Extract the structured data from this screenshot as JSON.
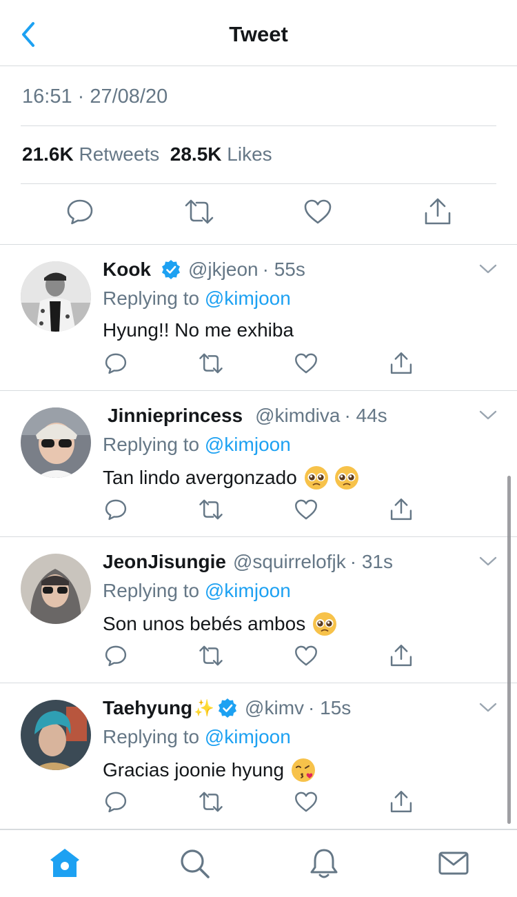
{
  "header": {
    "title": "Tweet",
    "back_icon": "chevron-left-icon"
  },
  "tweet": {
    "timestamp": "16:51 · 27/08/20",
    "retweets_count": "21.6K",
    "retweets_label": "Retweets",
    "likes_count": "28.5K",
    "likes_label": "Likes"
  },
  "colors": {
    "accent": "#1da1f2",
    "secondary_text": "#657786",
    "divider": "#d7dbde"
  },
  "replies": [
    {
      "name": "Kook",
      "verified": true,
      "handle": "@jkjeon",
      "time": "· 55s",
      "replying_prefix": "Replying to",
      "replying_to": "@kimjoon",
      "text": "Hyung!! No me exhiba"
    },
    {
      "name": "Jinnieprincess",
      "verified": false,
      "handle": "@kimdiva",
      "time": "· 44s",
      "replying_prefix": "Replying to",
      "replying_to": "@kimjoon",
      "text": "Tan lindo avergonzado",
      "emojis": [
        "pleading-face",
        "pleading-face"
      ]
    },
    {
      "name": "JeonJisungie",
      "verified": false,
      "handle": "@squirrelofjk",
      "time": "· 31s",
      "replying_prefix": "Replying to",
      "replying_to": "@kimjoon",
      "text": "Son unos bebés ambos",
      "emojis": [
        "pleading-face"
      ]
    },
    {
      "name": "Taehyung",
      "name_suffix": "✨",
      "verified": true,
      "handle": "@kimv",
      "time": "· 15s",
      "replying_prefix": "Replying to",
      "replying_to": "@kimjoon",
      "text": "Gracias joonie hyung",
      "emojis": [
        "face-blowing-a-kiss"
      ]
    }
  ],
  "tabbar": {
    "items": [
      "home-icon",
      "search-icon",
      "bell-icon",
      "mail-icon"
    ],
    "active": "home-icon"
  }
}
